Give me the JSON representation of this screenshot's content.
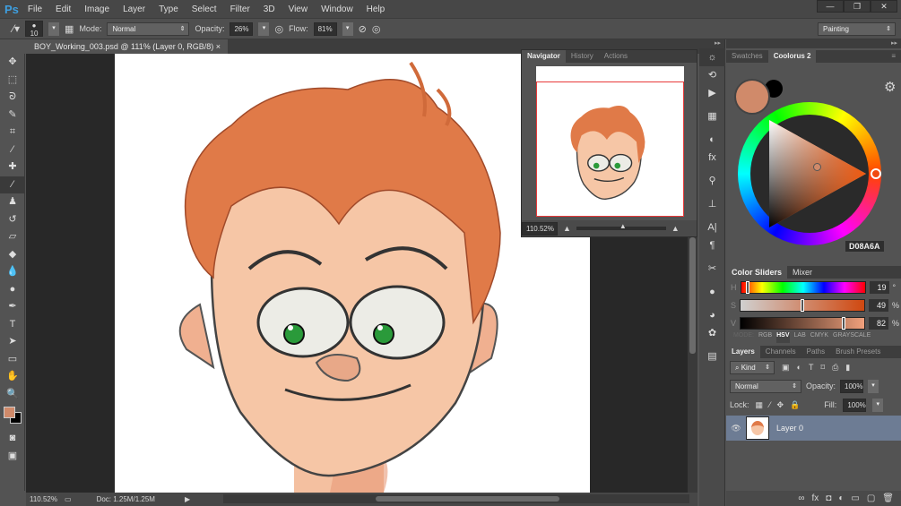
{
  "app": {
    "logo": "Ps",
    "menu": [
      "File",
      "Edit",
      "Image",
      "Layer",
      "Type",
      "Select",
      "Filter",
      "3D",
      "View",
      "Window",
      "Help"
    ],
    "window_controls": [
      "minimize",
      "restore",
      "close"
    ]
  },
  "options": {
    "brush_size": "10",
    "mode_label": "Mode:",
    "mode": "Normal",
    "opacity_label": "Opacity:",
    "opacity": "26%",
    "flow_label": "Flow:",
    "flow": "81%",
    "workspace": "Painting"
  },
  "document": {
    "tab_title": "BOY_Working_003.psd @ 111% (Layer 0, RGB/8)",
    "zoom": "110.52%",
    "doc_info": "Doc: 1.25M/1.25M"
  },
  "navigator": {
    "tabs": [
      "Navigator",
      "History",
      "Actions"
    ],
    "zoom": "110.52%"
  },
  "color": {
    "tabs": [
      "Swatches",
      "Coolorus 2"
    ],
    "hex": "D08A6A",
    "foreground": "#D08A6A",
    "background": "#000000"
  },
  "sliders": {
    "tabs": [
      "Color Sliders",
      "Mixer"
    ],
    "rows": [
      {
        "label": "H",
        "value": "19",
        "unit": "°"
      },
      {
        "label": "S",
        "value": "49",
        "unit": "%"
      },
      {
        "label": "V",
        "value": "82",
        "unit": "%"
      }
    ],
    "modes": [
      "MODE:",
      "RGB",
      "HSV",
      "LAB",
      "CMYK",
      "GRAYSCALE"
    ],
    "active_mode": "HSV"
  },
  "layers": {
    "tabs": [
      "Layers",
      "Channels",
      "Paths",
      "Brush Presets"
    ],
    "filter": "Kind",
    "blend": "Normal",
    "opacity_label": "Opacity:",
    "opacity": "100%",
    "lock_label": "Lock:",
    "fill_label": "Fill:",
    "fill": "100%",
    "items": [
      {
        "name": "Layer 0"
      }
    ]
  }
}
